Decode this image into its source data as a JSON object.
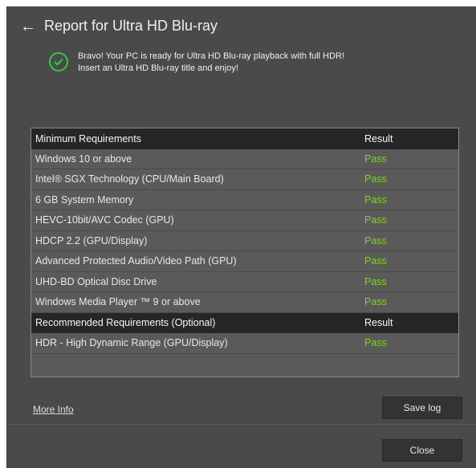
{
  "header": {
    "title": "Report for Ultra HD Blu-ray",
    "back_icon": "arrow-left-icon"
  },
  "status": {
    "icon": "check-circle-icon",
    "icon_color": "#2ecc40",
    "line1": "Bravo! Your PC is ready for Ultra HD Blu-ray playback with full HDR!",
    "line2": "Insert an Ultra HD Blu-ray title and enjoy!"
  },
  "table": {
    "pass_color": "#7ed321",
    "minimum_header": {
      "name": "Minimum Requirements",
      "result": "Result"
    },
    "minimum_rows": [
      {
        "name": "Windows 10 or above",
        "result": "Pass"
      },
      {
        "name": "Intel® SGX Technology (CPU/Main Board)",
        "result": "Pass"
      },
      {
        "name": "6 GB System Memory",
        "result": "Pass"
      },
      {
        "name": "HEVC-10bit/AVC Codec (GPU)",
        "result": "Pass"
      },
      {
        "name": "HDCP 2.2 (GPU/Display)",
        "result": "Pass"
      },
      {
        "name": "Advanced Protected Audio/Video Path (GPU)",
        "result": "Pass"
      },
      {
        "name": "UHD-BD Optical Disc Drive",
        "result": "Pass"
      },
      {
        "name": "Windows Media Player ™ 9 or above",
        "result": "Pass"
      }
    ],
    "recommended_header": {
      "name": "Recommended Requirements (Optional)",
      "result": "Result"
    },
    "recommended_rows": [
      {
        "name": "HDR - High Dynamic Range (GPU/Display)",
        "result": "Pass"
      }
    ]
  },
  "footer": {
    "more_info": "More Info",
    "save_log": "Save log",
    "close": "Close"
  }
}
